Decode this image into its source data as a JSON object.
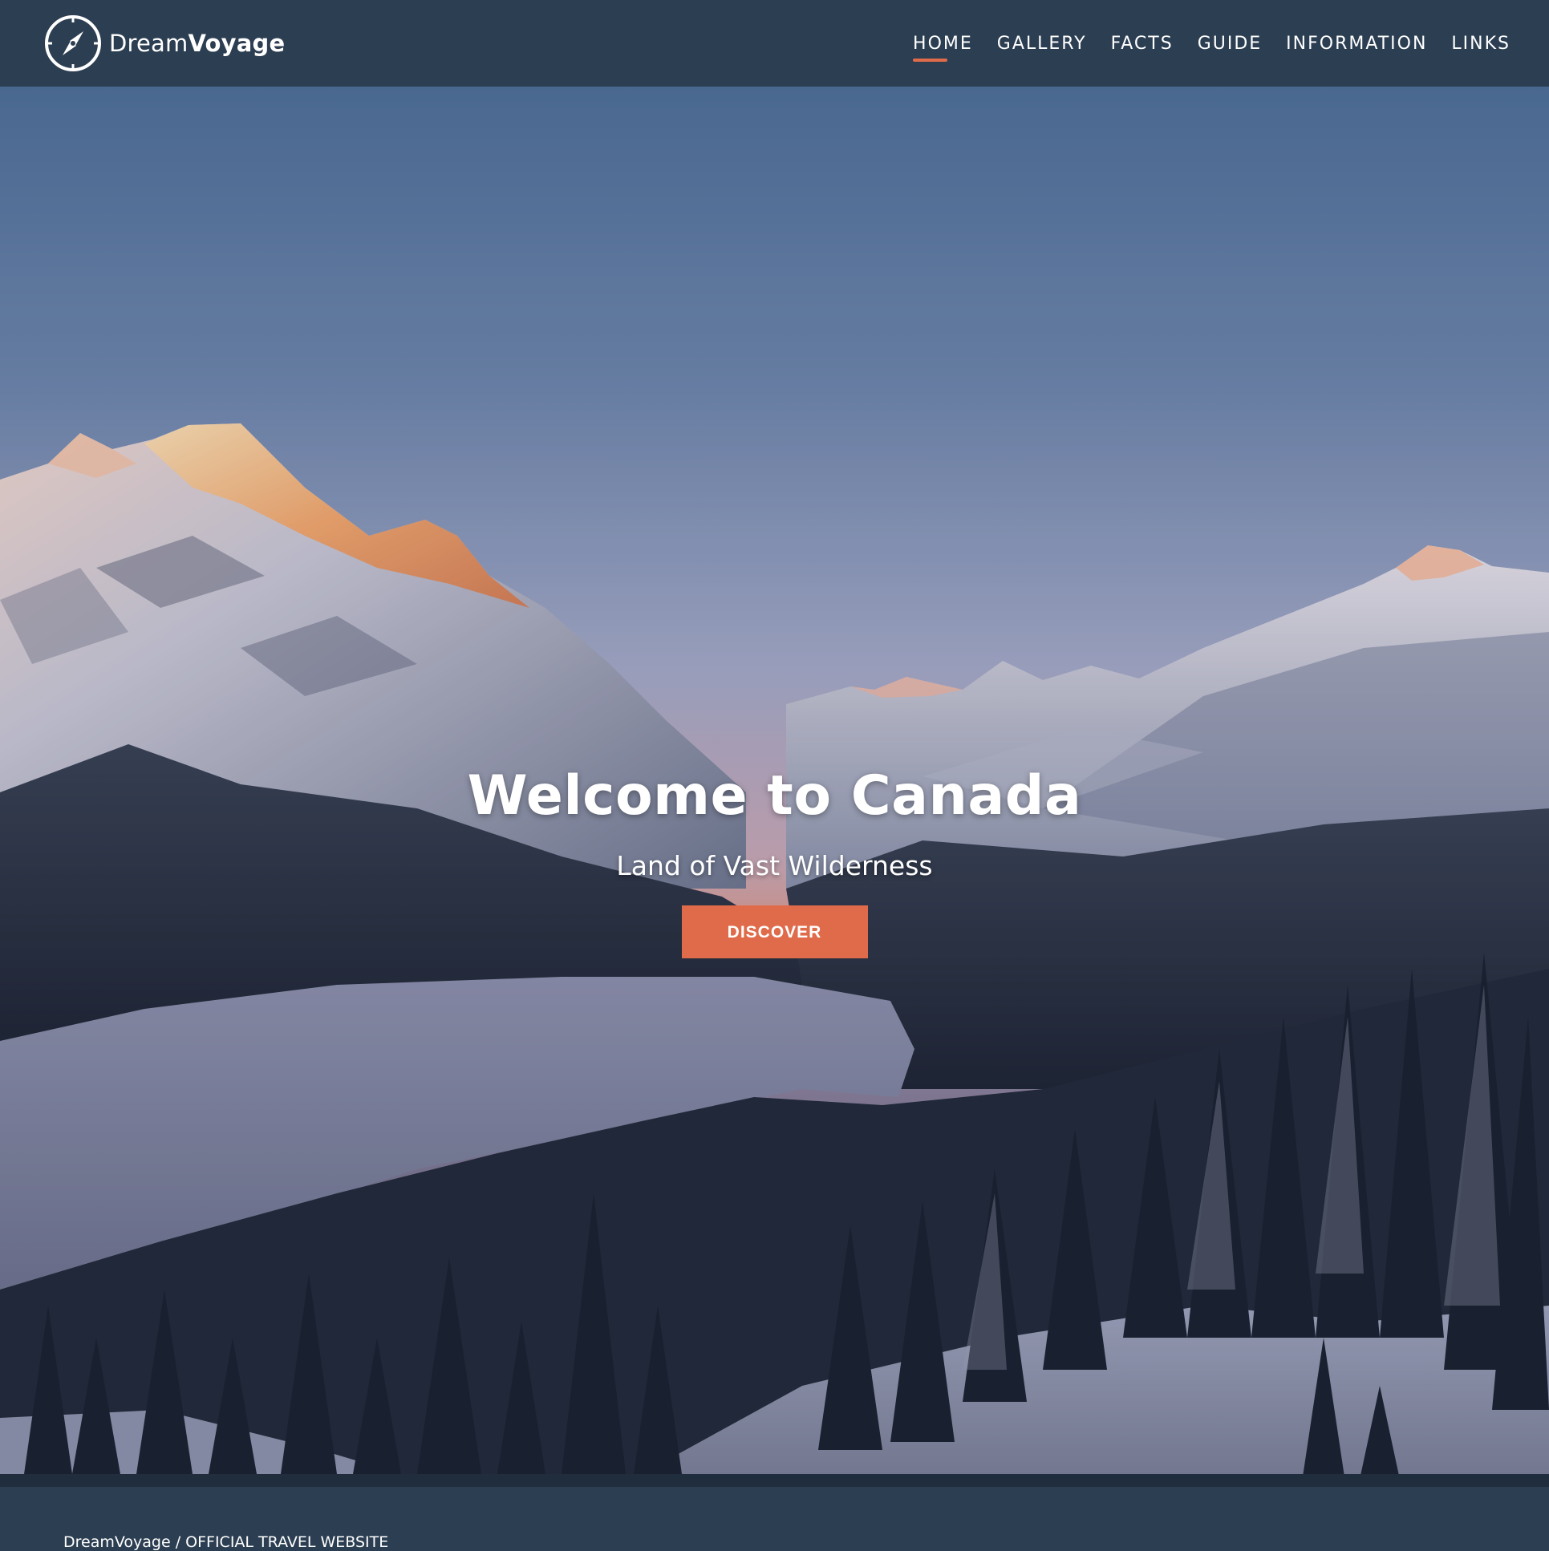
{
  "header": {
    "brand": {
      "light": "Dream",
      "bold": "Voyage",
      "icon": "compass-icon"
    },
    "nav": [
      {
        "label": "HOME",
        "active": true
      },
      {
        "label": "GALLERY",
        "active": false
      },
      {
        "label": "FACTS",
        "active": false
      },
      {
        "label": "GUIDE",
        "active": false
      },
      {
        "label": "INFORMATION",
        "active": false
      },
      {
        "label": "LINKS",
        "active": false
      }
    ]
  },
  "hero": {
    "title": "Welcome to Canada",
    "subtitle": "Land of Vast Wilderness",
    "cta_label": "DISCOVER",
    "image": "snowy-mountain-lake-sunset"
  },
  "footer": {
    "text": "DreamVoyage / OFFICIAL TRAVEL WEBSITE"
  },
  "colors": {
    "header_bg": "#2c3e52",
    "accent": "#e06b4a",
    "footer_strip": "#1f2d3c",
    "text": "#ffffff"
  }
}
